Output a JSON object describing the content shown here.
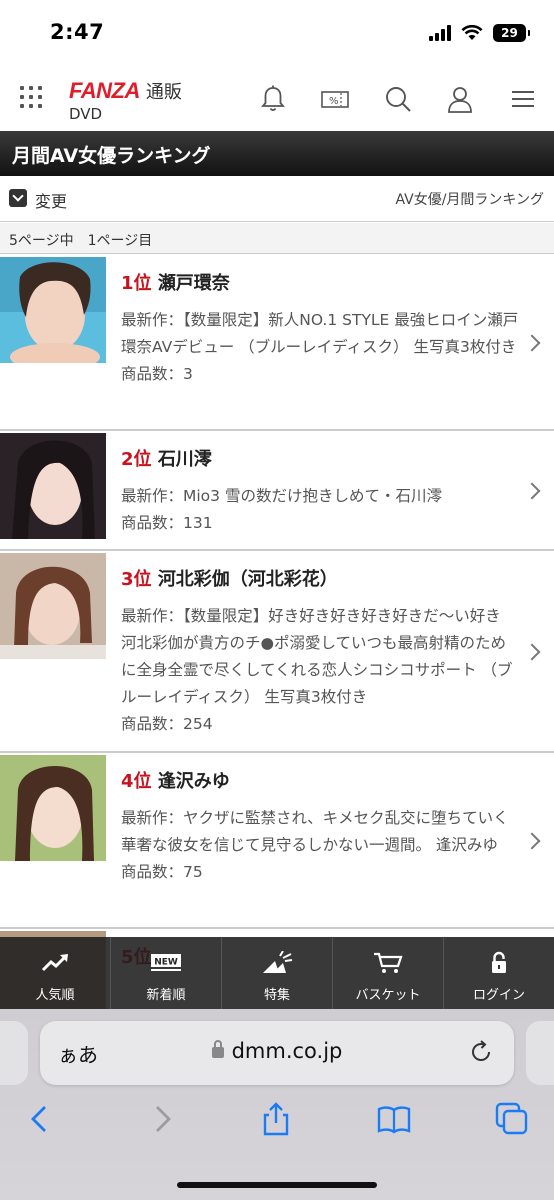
{
  "status": {
    "time": "2:47",
    "battery": "29"
  },
  "header": {
    "logo": "FANZA",
    "service": "通販",
    "category": "DVD"
  },
  "title": "月間AV女優ランキング",
  "subheader": {
    "change_label": "変更",
    "breadcrumb": "AV女優/月間ランキング"
  },
  "page_info": "5ページ中　1ページ目",
  "ranking": [
    {
      "rank": "1位",
      "name": "瀬戸環奈",
      "latest": "最新作：【数量限定】新人NO.1 STYLE 最強ヒロイン瀬戸環奈AVデビュー （ブルーレイディスク） 生写真3枚付き",
      "count": "商品数：3"
    },
    {
      "rank": "2位",
      "name": "石川澪",
      "latest": "最新作：Mio3 雪の数だけ抱きしめて・石川澪",
      "count": "商品数：131"
    },
    {
      "rank": "3位",
      "name": "河北彩伽（河北彩花）",
      "latest": "最新作：【数量限定】好き好き好き好き好きだ〜い好き 河北彩伽が貴方のチ●ポ溺愛していつも最高射精のために全身全霊で尽くしてくれる恋人シコシコサポート （ブルーレイディスク） 生写真3枚付き",
      "count": "商品数：254"
    },
    {
      "rank": "4位",
      "name": "逢沢みゆ",
      "latest": "最新作：ヤクザに監禁され、キメセク乱交に堕ちていく華奢な彼女を信じて見守るしかない一週間。 逢沢みゆ",
      "count": "商品数：75"
    },
    {
      "rank": "5位",
      "name": "",
      "latest": "",
      "count": ""
    }
  ],
  "bottom_nav": [
    {
      "label": "人気順",
      "icon": "trending-icon"
    },
    {
      "label": "新着順",
      "icon": "new-icon",
      "badge": "NEW"
    },
    {
      "label": "特集",
      "icon": "feature-icon"
    },
    {
      "label": "バスケット",
      "icon": "cart-icon"
    },
    {
      "label": "ログイン",
      "icon": "lock-icon"
    }
  ],
  "safari": {
    "aa": "ぁあ",
    "domain": "dmm.co.jp"
  },
  "colors": {
    "accent": "#c8131f",
    "brand": "#e01e2b"
  }
}
